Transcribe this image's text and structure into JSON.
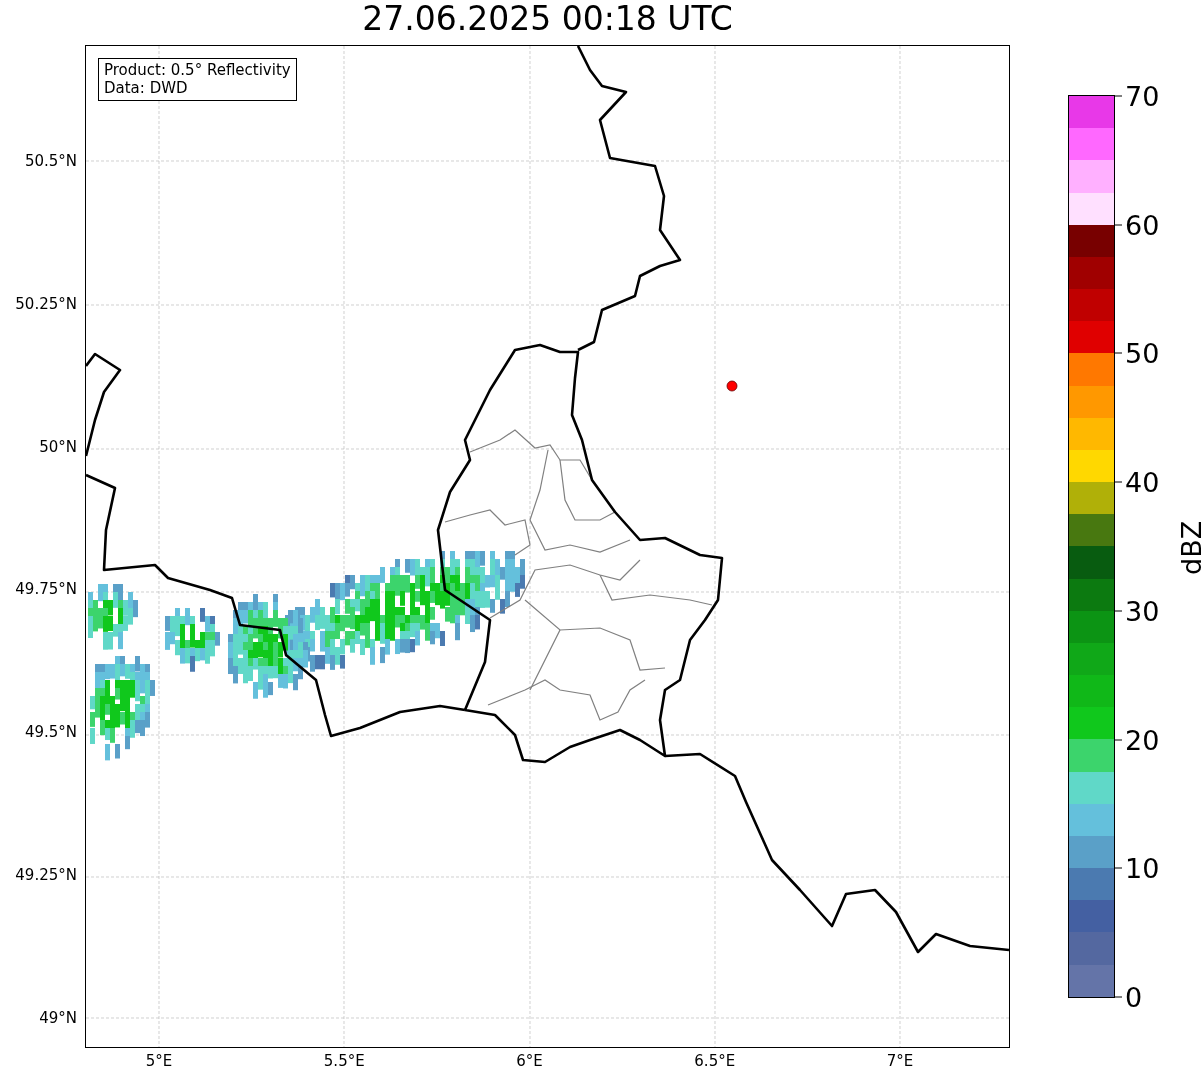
{
  "title": "27.06.2025 00:18 UTC",
  "legend_lines": [
    "Product: 0.5° Reflectivity",
    "Data: DWD"
  ],
  "lat_labels": [
    "50.5°N",
    "50.25°N",
    "50°N",
    "49.75°N",
    "49.5°N",
    "49.25°N",
    "49°N"
  ],
  "lon_labels": [
    "5°E",
    "5.5°E",
    "6°E",
    "6.5°E",
    "7°E"
  ],
  "colorbar": {
    "label": "dBZ",
    "ticks": [
      "70",
      "60",
      "50",
      "40",
      "30",
      "20",
      "10",
      "0"
    ],
    "bins": [
      {
        "color": "#e838e8"
      },
      {
        "color": "#ff68ff"
      },
      {
        "color": "#ffb0ff"
      },
      {
        "color": "#ffe0ff"
      },
      {
        "color": "#780000"
      },
      {
        "color": "#a00000"
      },
      {
        "color": "#c00000"
      },
      {
        "color": "#e00000"
      },
      {
        "color": "#ff7800"
      },
      {
        "color": "#ff9800"
      },
      {
        "color": "#ffb800"
      },
      {
        "color": "#ffd800"
      },
      {
        "color": "#b0b008"
      },
      {
        "color": "#487810"
      },
      {
        "color": "#085c10"
      },
      {
        "color": "#0c7a10"
      },
      {
        "color": "#0c9414"
      },
      {
        "color": "#10a818"
      },
      {
        "color": "#10b818"
      },
      {
        "color": "#10c81c"
      },
      {
        "color": "#3cd46c"
      },
      {
        "color": "#60d8c8"
      },
      {
        "color": "#64c0dc"
      },
      {
        "color": "#5aa0c8"
      },
      {
        "color": "#4b7ab0"
      },
      {
        "color": "#4460a2"
      },
      {
        "color": "#5468a0"
      },
      {
        "color": "#6474a8"
      }
    ]
  }
}
